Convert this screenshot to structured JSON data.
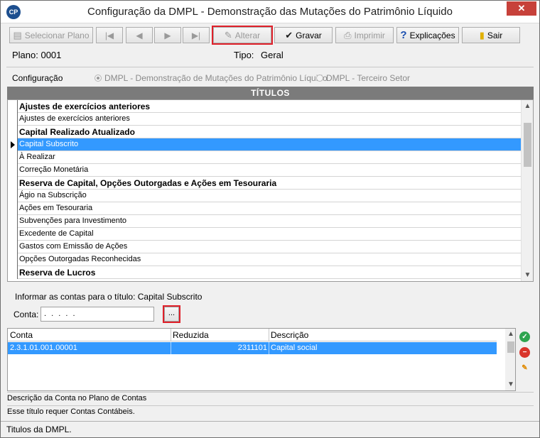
{
  "window": {
    "app_icon": "CP",
    "title": "Configuração da DMPL - Demonstração das Mutações do Patrimônio Líquido",
    "close_glyph": "✕"
  },
  "toolbar": {
    "selecionar": {
      "label": "Selecionar Plano",
      "icon": "select-plan-icon",
      "glyph": "▤"
    },
    "first_glyph": "|◀",
    "prev_glyph": "◀",
    "next_glyph": "▶",
    "last_glyph": "▶|",
    "alterar": {
      "label": "Alterar",
      "icon": "edit-icon",
      "glyph": "✎"
    },
    "gravar": {
      "label": "Gravar",
      "icon": "check-icon",
      "glyph": "✔"
    },
    "imprimir": {
      "label": "Imprimir",
      "icon": "printer-icon",
      "glyph": "⎙"
    },
    "explicacoes": {
      "label": "Explicações",
      "icon": "help-icon",
      "glyph": "?"
    },
    "sair": {
      "label": "Sair",
      "icon": "exit-door-icon",
      "glyph": "▮"
    }
  },
  "info": {
    "plano_label": "Plano: 0001",
    "tipo_label": "Tipo:",
    "tipo_value": "Geral"
  },
  "configuracao": {
    "label": "Configuração",
    "option1": "DMPL - Demonstração de Mutações do Patrimônio Líquido",
    "option2": "DMPL - Terceiro Setor",
    "selected": "option1"
  },
  "titulos": {
    "header": "TÍTULOS",
    "rows": [
      {
        "text": "Ajustes de exercícios anteriores",
        "bold": true
      },
      {
        "text": "Ajustes de exercícios anteriores",
        "bold": false
      },
      {
        "text": "Capital Realizado Atualizado",
        "bold": true
      },
      {
        "text": "Capital Subscrito",
        "bold": false,
        "selected": true
      },
      {
        "text": "À Realizar",
        "bold": false
      },
      {
        "text": "Correção Monetária",
        "bold": false
      },
      {
        "text": "Reserva de Capital, Opções Outorgadas e Ações em Tesouraria",
        "bold": true
      },
      {
        "text": "Ágio na Subscrição",
        "bold": false
      },
      {
        "text": "Ações em Tesouraria",
        "bold": false
      },
      {
        "text": "Subvenções para Investimento",
        "bold": false
      },
      {
        "text": "Excedente de Capital",
        "bold": false
      },
      {
        "text": "Gastos com Emissão de Ações",
        "bold": false
      },
      {
        "text": "Opções Outorgadas Reconhecidas",
        "bold": false
      },
      {
        "text": "Reserva de Lucros",
        "bold": true
      }
    ]
  },
  "informar": {
    "text": "Informar as contas para o título: Capital Subscrito",
    "conta_label": "Conta:",
    "conta_value": ". . . . .",
    "lookup_label": "..."
  },
  "contas": {
    "headers": [
      "Conta",
      "Reduzida",
      "Descrição"
    ],
    "rows": [
      {
        "conta": "2.3.1.01.001.00001",
        "reduzida": "2311101",
        "descricao": "Capital social"
      }
    ]
  },
  "side_actions": {
    "add_glyph": "✓",
    "remove_glyph": "−",
    "clear_glyph": "✎"
  },
  "status": {
    "descricao": "Descrição da Conta no Plano de Contas",
    "aviso": "Esse título requer Contas Contábeis.",
    "bottom": "Titulos da DMPL."
  }
}
